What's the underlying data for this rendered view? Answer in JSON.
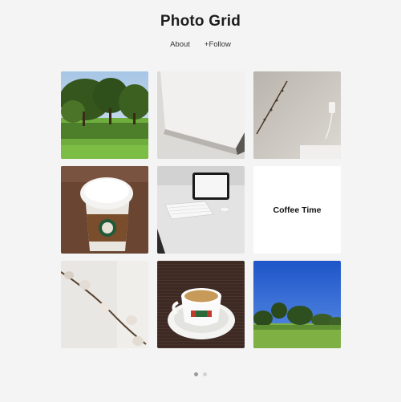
{
  "header": {
    "title": "Photo Grid"
  },
  "nav": {
    "about_label": "About",
    "follow_label": "+Follow"
  },
  "grid": {
    "text_tile_label": "Coffee Time",
    "photos": [
      "park-trees-photo",
      "white-canvas-photo",
      "willow-branch-wall-photo",
      "coffee-cup-photo",
      "tablet-keyboard-desk-photo",
      "pussy-willow-branch-photo",
      "espresso-cup-photo",
      "park-blue-sky-photo"
    ]
  },
  "pagination": {
    "page_count": 2,
    "current_page": 1
  }
}
